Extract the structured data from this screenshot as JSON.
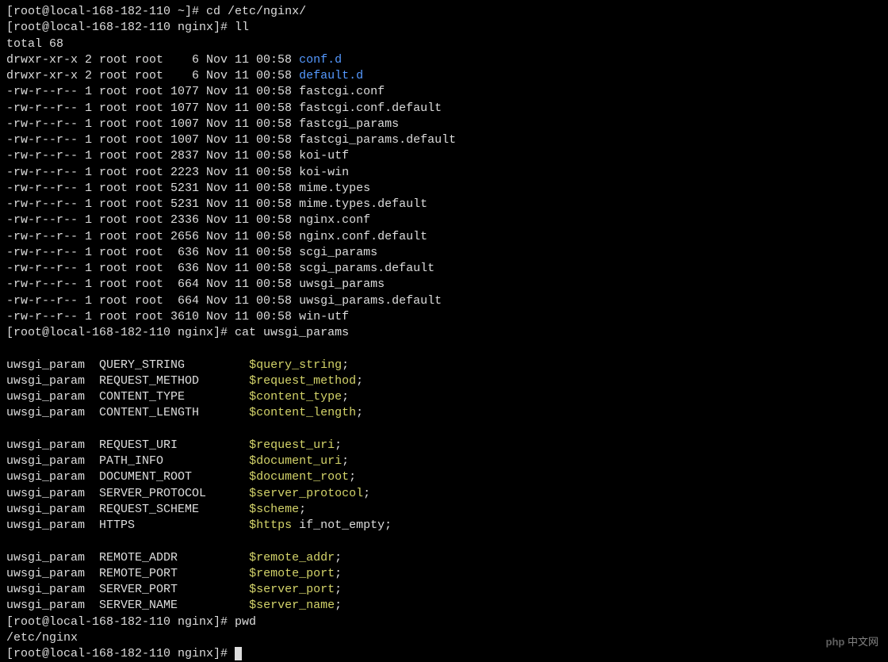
{
  "prompt": {
    "home": "[root@local-168-182-110 ~]# ",
    "nginx": "[root@local-168-182-110 nginx]# "
  },
  "cmds": {
    "cd": "cd /etc/nginx/",
    "ll": "ll",
    "cat": "cat uwsgi_params",
    "pwd": "pwd"
  },
  "ll": {
    "total": "total 68",
    "entries": [
      {
        "perms": "drwxr-xr-x",
        "links": "2",
        "user": "root",
        "group": "root",
        "size": "   6",
        "date": "Nov 11 00:58",
        "name": "conf.d",
        "type": "dir"
      },
      {
        "perms": "drwxr-xr-x",
        "links": "2",
        "user": "root",
        "group": "root",
        "size": "   6",
        "date": "Nov 11 00:58",
        "name": "default.d",
        "type": "dir"
      },
      {
        "perms": "-rw-r--r--",
        "links": "1",
        "user": "root",
        "group": "root",
        "size": "1077",
        "date": "Nov 11 00:58",
        "name": "fastcgi.conf",
        "type": "file"
      },
      {
        "perms": "-rw-r--r--",
        "links": "1",
        "user": "root",
        "group": "root",
        "size": "1077",
        "date": "Nov 11 00:58",
        "name": "fastcgi.conf.default",
        "type": "file"
      },
      {
        "perms": "-rw-r--r--",
        "links": "1",
        "user": "root",
        "group": "root",
        "size": "1007",
        "date": "Nov 11 00:58",
        "name": "fastcgi_params",
        "type": "file"
      },
      {
        "perms": "-rw-r--r--",
        "links": "1",
        "user": "root",
        "group": "root",
        "size": "1007",
        "date": "Nov 11 00:58",
        "name": "fastcgi_params.default",
        "type": "file"
      },
      {
        "perms": "-rw-r--r--",
        "links": "1",
        "user": "root",
        "group": "root",
        "size": "2837",
        "date": "Nov 11 00:58",
        "name": "koi-utf",
        "type": "file"
      },
      {
        "perms": "-rw-r--r--",
        "links": "1",
        "user": "root",
        "group": "root",
        "size": "2223",
        "date": "Nov 11 00:58",
        "name": "koi-win",
        "type": "file"
      },
      {
        "perms": "-rw-r--r--",
        "links": "1",
        "user": "root",
        "group": "root",
        "size": "5231",
        "date": "Nov 11 00:58",
        "name": "mime.types",
        "type": "file"
      },
      {
        "perms": "-rw-r--r--",
        "links": "1",
        "user": "root",
        "group": "root",
        "size": "5231",
        "date": "Nov 11 00:58",
        "name": "mime.types.default",
        "type": "file"
      },
      {
        "perms": "-rw-r--r--",
        "links": "1",
        "user": "root",
        "group": "root",
        "size": "2336",
        "date": "Nov 11 00:58",
        "name": "nginx.conf",
        "type": "file"
      },
      {
        "perms": "-rw-r--r--",
        "links": "1",
        "user": "root",
        "group": "root",
        "size": "2656",
        "date": "Nov 11 00:58",
        "name": "nginx.conf.default",
        "type": "file"
      },
      {
        "perms": "-rw-r--r--",
        "links": "1",
        "user": "root",
        "group": "root",
        "size": " 636",
        "date": "Nov 11 00:58",
        "name": "scgi_params",
        "type": "file"
      },
      {
        "perms": "-rw-r--r--",
        "links": "1",
        "user": "root",
        "group": "root",
        "size": " 636",
        "date": "Nov 11 00:58",
        "name": "scgi_params.default",
        "type": "file"
      },
      {
        "perms": "-rw-r--r--",
        "links": "1",
        "user": "root",
        "group": "root",
        "size": " 664",
        "date": "Nov 11 00:58",
        "name": "uwsgi_params",
        "type": "file"
      },
      {
        "perms": "-rw-r--r--",
        "links": "1",
        "user": "root",
        "group": "root",
        "size": " 664",
        "date": "Nov 11 00:58",
        "name": "uwsgi_params.default",
        "type": "file"
      },
      {
        "perms": "-rw-r--r--",
        "links": "1",
        "user": "root",
        "group": "root",
        "size": "3610",
        "date": "Nov 11 00:58",
        "name": "win-utf",
        "type": "file"
      }
    ]
  },
  "uwsgi_params": [
    [
      {
        "key": "QUERY_STRING",
        "var": "$query_string",
        "suffix": ";"
      },
      {
        "key": "REQUEST_METHOD",
        "var": "$request_method",
        "suffix": ";"
      },
      {
        "key": "CONTENT_TYPE",
        "var": "$content_type",
        "suffix": ";"
      },
      {
        "key": "CONTENT_LENGTH",
        "var": "$content_length",
        "suffix": ";"
      }
    ],
    [
      {
        "key": "REQUEST_URI",
        "var": "$request_uri",
        "suffix": ";"
      },
      {
        "key": "PATH_INFO",
        "var": "$document_uri",
        "suffix": ";"
      },
      {
        "key": "DOCUMENT_ROOT",
        "var": "$document_root",
        "suffix": ";"
      },
      {
        "key": "SERVER_PROTOCOL",
        "var": "$server_protocol",
        "suffix": ";"
      },
      {
        "key": "REQUEST_SCHEME",
        "var": "$scheme",
        "suffix": ";"
      },
      {
        "key": "HTTPS",
        "var": "$https",
        "suffix": " if_not_empty;"
      }
    ],
    [
      {
        "key": "REMOTE_ADDR",
        "var": "$remote_addr",
        "suffix": ";"
      },
      {
        "key": "REMOTE_PORT",
        "var": "$remote_port",
        "suffix": ";"
      },
      {
        "key": "SERVER_PORT",
        "var": "$server_port",
        "suffix": ";"
      },
      {
        "key": "SERVER_NAME",
        "var": "$server_name",
        "suffix": ";"
      }
    ]
  ],
  "pwd_output": "/etc/nginx",
  "watermark": {
    "tag": "php",
    "text": "中文网"
  }
}
